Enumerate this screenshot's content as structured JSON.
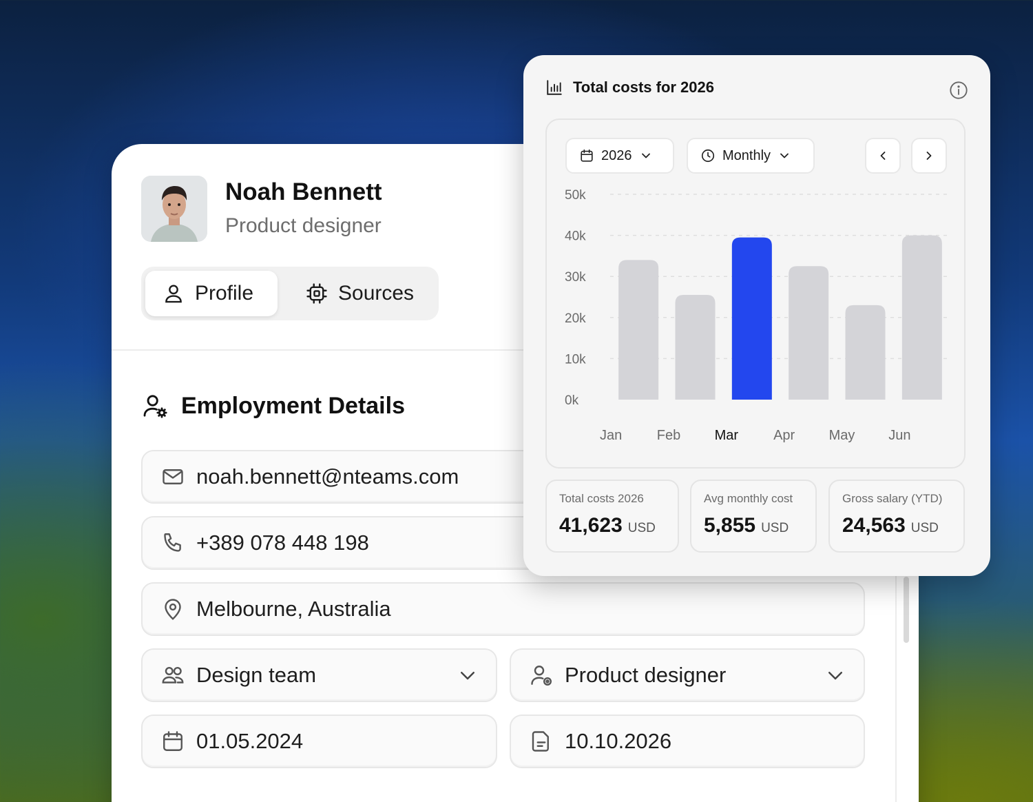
{
  "profile": {
    "name": "Noah Bennett",
    "role": "Product designer",
    "tabs": [
      {
        "label": "Profile",
        "icon": "user-icon",
        "active": true
      },
      {
        "label": "Sources",
        "icon": "chip-icon",
        "active": false
      }
    ]
  },
  "employment": {
    "title": "Employment Details",
    "email": "noah.bennett@nteams.com",
    "phone": "+389 078 448 198",
    "location": "Melbourne, Australia",
    "team": "Design team",
    "position": "Product designer",
    "start_date": "01.05.2024",
    "end_date": "10.10.2026"
  },
  "costs_widget": {
    "title": "Total costs for 2026",
    "year_select": "2026",
    "period_select": "Monthly",
    "stats": [
      {
        "label": "Total costs 2026",
        "value": "41,623",
        "unit": "USD"
      },
      {
        "label": "Avg monthly cost",
        "value": "5,855",
        "unit": "USD"
      },
      {
        "label": "Gross salary (YTD)",
        "value": "24,563",
        "unit": "USD"
      }
    ]
  },
  "colors": {
    "highlight_bar": "#2347ee",
    "default_bar": "#d4d4d8"
  },
  "chart_data": {
    "type": "bar",
    "categories": [
      "Jan",
      "Feb",
      "Mar",
      "Apr",
      "May",
      "Jun"
    ],
    "values": [
      34000,
      25500,
      39500,
      32500,
      23000,
      40000
    ],
    "highlight": "Mar",
    "y_ticks": [
      "50k",
      "40k",
      "30k",
      "20k",
      "10k",
      "0k"
    ],
    "ylim": [
      0,
      50000
    ],
    "grid": true
  }
}
